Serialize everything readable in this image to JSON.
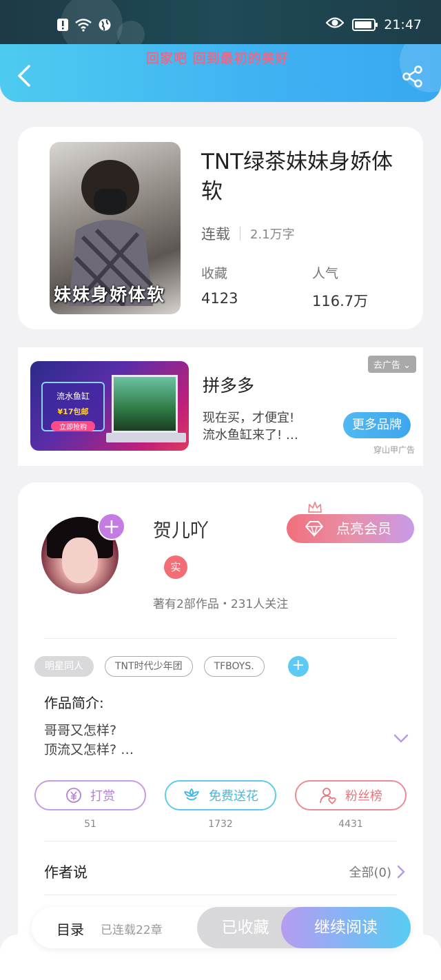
{
  "status_bar": {
    "time": "21:47"
  },
  "header": {
    "marquee": "回家吧 回到最初的美好"
  },
  "book": {
    "title": "TNT绿茶妹妹身娇体软",
    "cover_text": "妹妹身娇体软",
    "status": "连载",
    "word_count": "2.1万字",
    "favorites_label": "收藏",
    "favorites_value": "4123",
    "popularity_label": "人气",
    "popularity_value": "116.7万"
  },
  "ad": {
    "close_label": "去广告",
    "brand": "拼多多",
    "desc_line1": "现在买，才便宜!",
    "desc_line2": "流水鱼缸来了! …",
    "cta": "更多品牌",
    "source": "穿山甲广告",
    "image_title": "流水鱼缸",
    "image_price": "¥17包邮",
    "image_button": "立即抢购"
  },
  "author": {
    "name": "贺儿吖",
    "real_badge": "实",
    "meta": "著有2部作品・231人关注",
    "vip_button": "点亮会员",
    "follow_plus": "+"
  },
  "tags": [
    "明星同人",
    "TNT时代少年团",
    "TFBOYS."
  ],
  "tag_add": "+",
  "intro": {
    "heading": "作品简介:",
    "line1": "哥哥又怎样?",
    "line2": "顶流又怎样? …"
  },
  "actions": [
    {
      "label": "打赏",
      "count": "51",
      "icon": "coin-icon"
    },
    {
      "label": "免费送花",
      "count": "1732",
      "icon": "flower-icon"
    },
    {
      "label": "粉丝榜",
      "count": "4431",
      "icon": "fans-icon"
    }
  ],
  "author_says": {
    "heading": "作者说",
    "all_label": "全部(0)"
  },
  "bottom_bar": {
    "toc": "目录",
    "toc_meta": "已连载22章",
    "collected": "已收藏",
    "continue": "继续阅读"
  }
}
